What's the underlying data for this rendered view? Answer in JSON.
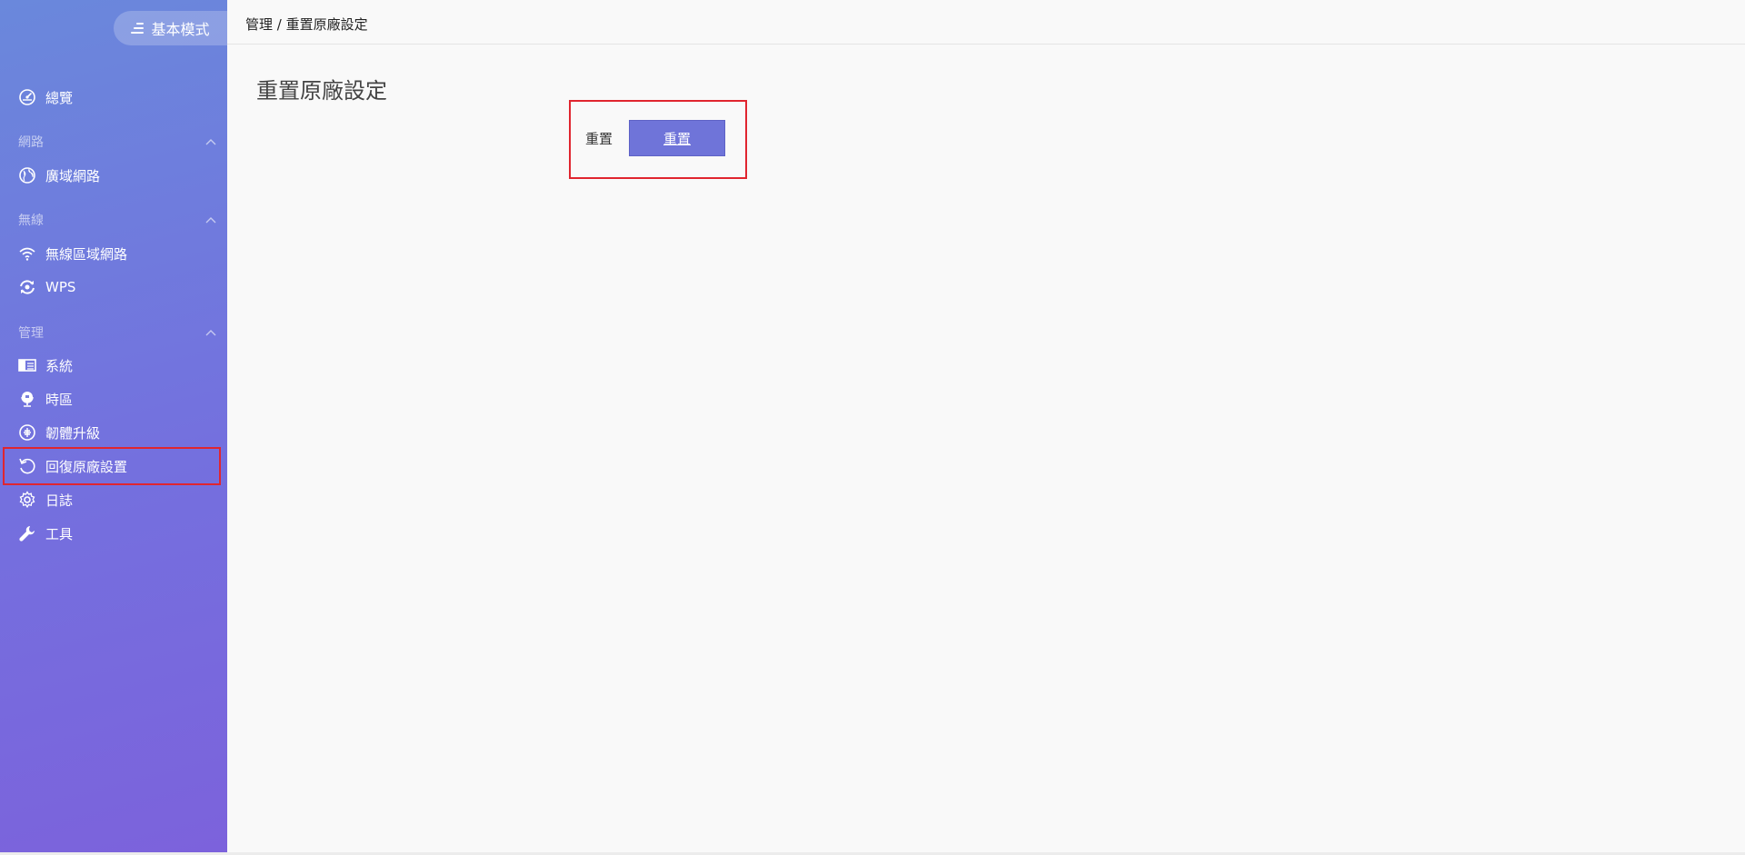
{
  "sidebar": {
    "mode_label": "基本模式",
    "items": {
      "overview": "總覽",
      "wan": "廣域網路",
      "wlan": "無線區域網路",
      "wps": "WPS",
      "system": "系統",
      "timezone": "時區",
      "firmware": "韌體升級",
      "factory_reset": "回復原廠設置",
      "log": "日誌",
      "tools": "工具"
    },
    "sections": {
      "network": "網路",
      "wireless": "無線",
      "management": "管理"
    }
  },
  "main": {
    "breadcrumb": "管理 / 重置原廠設定",
    "title": "重置原廠設定",
    "reset_label": "重置",
    "reset_button": "重置"
  },
  "colors": {
    "accent": "#6f74d9",
    "highlight": "#e0252f"
  }
}
